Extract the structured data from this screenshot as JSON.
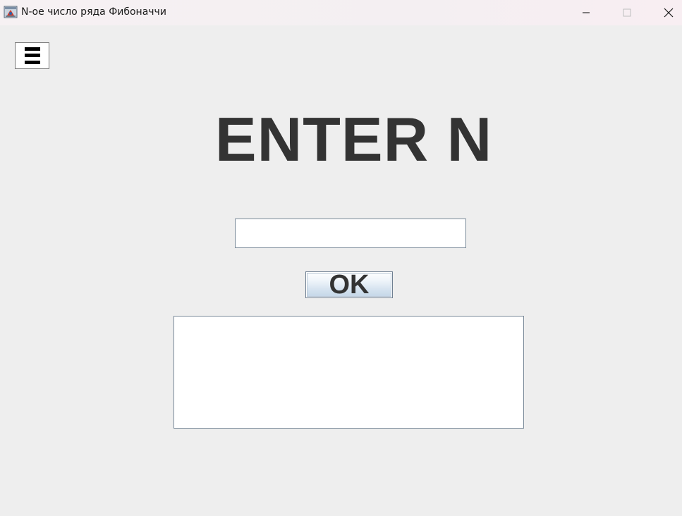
{
  "window": {
    "title": "N-ое число ряда Фибоначчи",
    "app_icon": "java-app-icon",
    "controls": {
      "minimize_icon": "minimize-icon",
      "maximize_icon": "maximize-icon",
      "close_icon": "close-icon"
    }
  },
  "menu": {
    "icon": "hamburger-menu-icon"
  },
  "main": {
    "heading": "ENTER N",
    "n_input": {
      "value": "",
      "placeholder": ""
    },
    "ok_label": "OK",
    "output": {
      "value": ""
    }
  },
  "colors": {
    "background": "#eeeeee",
    "heading_text": "#333333",
    "button_gradient_top": "#ffffff",
    "button_gradient_bottom": "#c3d5e6",
    "field_border": "#7a8a99"
  }
}
